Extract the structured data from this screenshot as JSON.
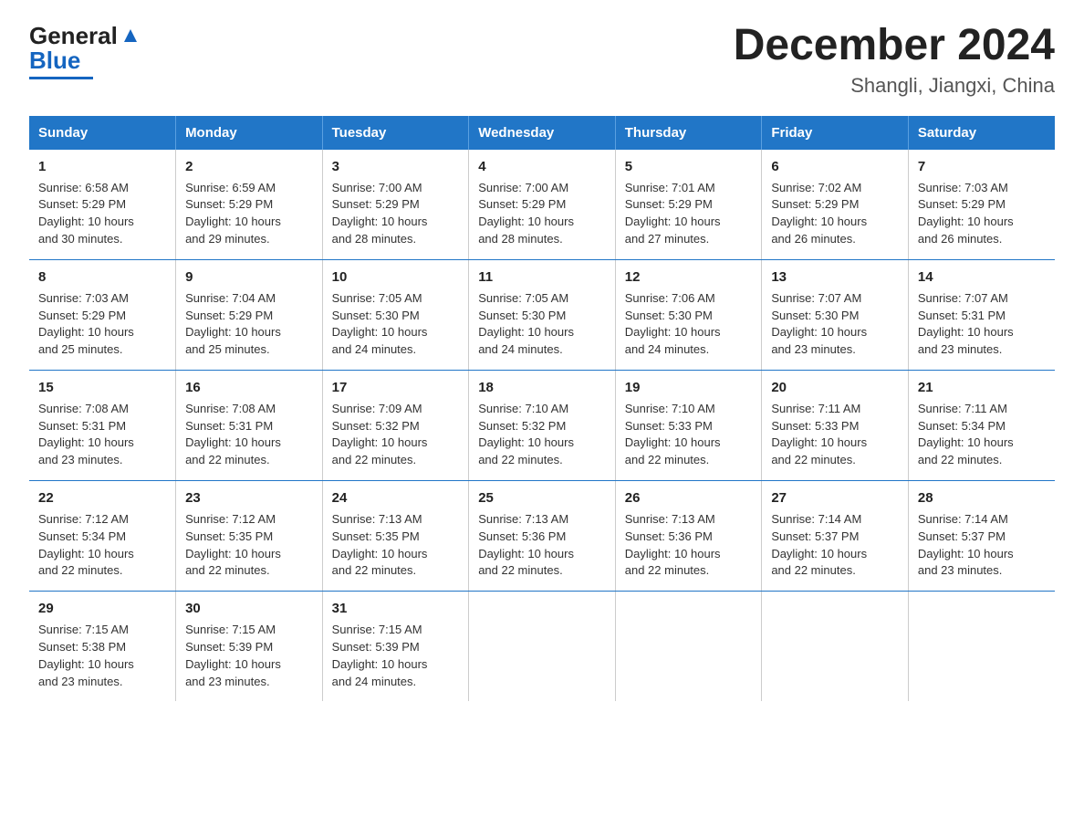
{
  "logo": {
    "general": "General",
    "blue": "Blue"
  },
  "title": "December 2024",
  "subtitle": "Shangli, Jiangxi, China",
  "weekdays": [
    "Sunday",
    "Monday",
    "Tuesday",
    "Wednesday",
    "Thursday",
    "Friday",
    "Saturday"
  ],
  "weeks": [
    [
      {
        "day": "1",
        "info": "Sunrise: 6:58 AM\nSunset: 5:29 PM\nDaylight: 10 hours\nand 30 minutes."
      },
      {
        "day": "2",
        "info": "Sunrise: 6:59 AM\nSunset: 5:29 PM\nDaylight: 10 hours\nand 29 minutes."
      },
      {
        "day": "3",
        "info": "Sunrise: 7:00 AM\nSunset: 5:29 PM\nDaylight: 10 hours\nand 28 minutes."
      },
      {
        "day": "4",
        "info": "Sunrise: 7:00 AM\nSunset: 5:29 PM\nDaylight: 10 hours\nand 28 minutes."
      },
      {
        "day": "5",
        "info": "Sunrise: 7:01 AM\nSunset: 5:29 PM\nDaylight: 10 hours\nand 27 minutes."
      },
      {
        "day": "6",
        "info": "Sunrise: 7:02 AM\nSunset: 5:29 PM\nDaylight: 10 hours\nand 26 minutes."
      },
      {
        "day": "7",
        "info": "Sunrise: 7:03 AM\nSunset: 5:29 PM\nDaylight: 10 hours\nand 26 minutes."
      }
    ],
    [
      {
        "day": "8",
        "info": "Sunrise: 7:03 AM\nSunset: 5:29 PM\nDaylight: 10 hours\nand 25 minutes."
      },
      {
        "day": "9",
        "info": "Sunrise: 7:04 AM\nSunset: 5:29 PM\nDaylight: 10 hours\nand 25 minutes."
      },
      {
        "day": "10",
        "info": "Sunrise: 7:05 AM\nSunset: 5:30 PM\nDaylight: 10 hours\nand 24 minutes."
      },
      {
        "day": "11",
        "info": "Sunrise: 7:05 AM\nSunset: 5:30 PM\nDaylight: 10 hours\nand 24 minutes."
      },
      {
        "day": "12",
        "info": "Sunrise: 7:06 AM\nSunset: 5:30 PM\nDaylight: 10 hours\nand 24 minutes."
      },
      {
        "day": "13",
        "info": "Sunrise: 7:07 AM\nSunset: 5:30 PM\nDaylight: 10 hours\nand 23 minutes."
      },
      {
        "day": "14",
        "info": "Sunrise: 7:07 AM\nSunset: 5:31 PM\nDaylight: 10 hours\nand 23 minutes."
      }
    ],
    [
      {
        "day": "15",
        "info": "Sunrise: 7:08 AM\nSunset: 5:31 PM\nDaylight: 10 hours\nand 23 minutes."
      },
      {
        "day": "16",
        "info": "Sunrise: 7:08 AM\nSunset: 5:31 PM\nDaylight: 10 hours\nand 22 minutes."
      },
      {
        "day": "17",
        "info": "Sunrise: 7:09 AM\nSunset: 5:32 PM\nDaylight: 10 hours\nand 22 minutes."
      },
      {
        "day": "18",
        "info": "Sunrise: 7:10 AM\nSunset: 5:32 PM\nDaylight: 10 hours\nand 22 minutes."
      },
      {
        "day": "19",
        "info": "Sunrise: 7:10 AM\nSunset: 5:33 PM\nDaylight: 10 hours\nand 22 minutes."
      },
      {
        "day": "20",
        "info": "Sunrise: 7:11 AM\nSunset: 5:33 PM\nDaylight: 10 hours\nand 22 minutes."
      },
      {
        "day": "21",
        "info": "Sunrise: 7:11 AM\nSunset: 5:34 PM\nDaylight: 10 hours\nand 22 minutes."
      }
    ],
    [
      {
        "day": "22",
        "info": "Sunrise: 7:12 AM\nSunset: 5:34 PM\nDaylight: 10 hours\nand 22 minutes."
      },
      {
        "day": "23",
        "info": "Sunrise: 7:12 AM\nSunset: 5:35 PM\nDaylight: 10 hours\nand 22 minutes."
      },
      {
        "day": "24",
        "info": "Sunrise: 7:13 AM\nSunset: 5:35 PM\nDaylight: 10 hours\nand 22 minutes."
      },
      {
        "day": "25",
        "info": "Sunrise: 7:13 AM\nSunset: 5:36 PM\nDaylight: 10 hours\nand 22 minutes."
      },
      {
        "day": "26",
        "info": "Sunrise: 7:13 AM\nSunset: 5:36 PM\nDaylight: 10 hours\nand 22 minutes."
      },
      {
        "day": "27",
        "info": "Sunrise: 7:14 AM\nSunset: 5:37 PM\nDaylight: 10 hours\nand 22 minutes."
      },
      {
        "day": "28",
        "info": "Sunrise: 7:14 AM\nSunset: 5:37 PM\nDaylight: 10 hours\nand 23 minutes."
      }
    ],
    [
      {
        "day": "29",
        "info": "Sunrise: 7:15 AM\nSunset: 5:38 PM\nDaylight: 10 hours\nand 23 minutes."
      },
      {
        "day": "30",
        "info": "Sunrise: 7:15 AM\nSunset: 5:39 PM\nDaylight: 10 hours\nand 23 minutes."
      },
      {
        "day": "31",
        "info": "Sunrise: 7:15 AM\nSunset: 5:39 PM\nDaylight: 10 hours\nand 24 minutes."
      },
      {
        "day": "",
        "info": ""
      },
      {
        "day": "",
        "info": ""
      },
      {
        "day": "",
        "info": ""
      },
      {
        "day": "",
        "info": ""
      }
    ]
  ]
}
